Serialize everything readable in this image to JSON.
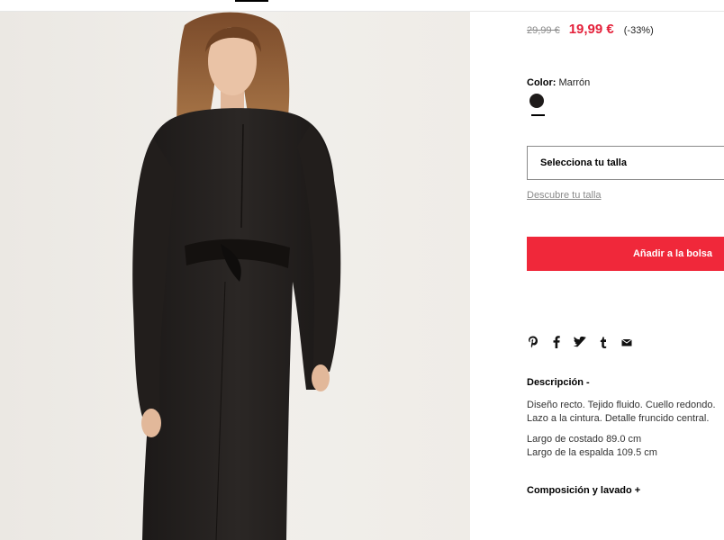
{
  "product": {
    "image_alt": "Vestido nudo marrón",
    "price_old": "29,99 €",
    "price_new": "19,99 €",
    "discount": "(-33%)",
    "color_label": "Color:",
    "color_value": "Marrón",
    "swatch_color": "#1e1b1a",
    "size_select_label": "Selecciona tu talla",
    "size_guide_link": "Descubre tu talla",
    "add_to_bag": "Añadir a la bolsa",
    "accent_color": "#f0283a",
    "price_color": "#e4203a"
  },
  "share": {
    "icons": [
      "pinterest-icon",
      "facebook-icon",
      "twitter-icon",
      "tumblr-icon",
      "email-icon"
    ]
  },
  "description": {
    "title": "Descripción -",
    "line1": "Diseño recto. Tejido fluido. Cuello redondo.",
    "line2": "Lazo a la cintura. Detalle fruncido central.",
    "measure1": "Largo de costado 89.0 cm",
    "measure2": "Largo de la espalda 109.5 cm"
  },
  "composition": {
    "title": "Composición y lavado +"
  }
}
